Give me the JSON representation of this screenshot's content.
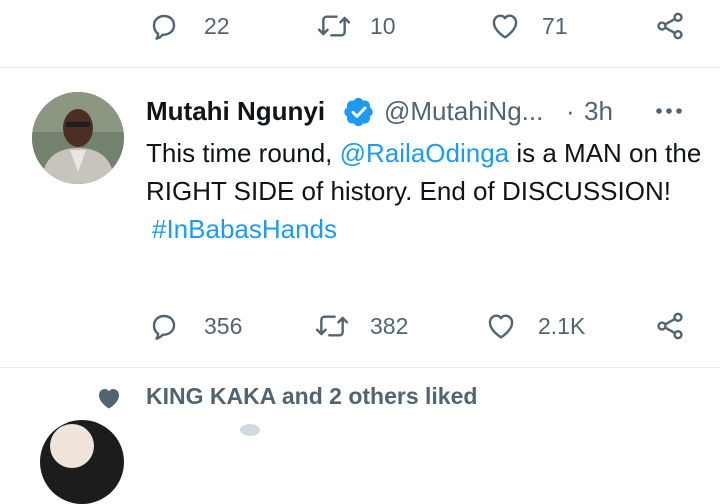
{
  "prev_tweet": {
    "actions": {
      "replies": "22",
      "retweets": "10",
      "likes": "71"
    }
  },
  "tweet": {
    "author": {
      "display_name": "Mutahi Ngunyi",
      "handle": "@MutahiNg...",
      "verified": true
    },
    "separator": "·",
    "time": "3h",
    "text": {
      "part1": "This time round, ",
      "mention": "@RailaOdinga",
      "part2": " is a MAN on the RIGHT SIDE of history. End of DISCUSSION!",
      "hashtag": "#InBabasHands"
    },
    "actions": {
      "replies": "356",
      "retweets": "382",
      "likes": "2.1K"
    }
  },
  "liked_banner": {
    "text": "KING KAKA and 2 others liked"
  },
  "colors": {
    "link": "#1d9bf0",
    "secondary_text": "#536471",
    "divider": "#e6ecf0"
  },
  "icons": {
    "reply": "reply-icon",
    "retweet": "retweet-icon",
    "like": "like-icon",
    "share": "share-icon",
    "verified": "verified-badge-icon",
    "more": "more-icon"
  }
}
